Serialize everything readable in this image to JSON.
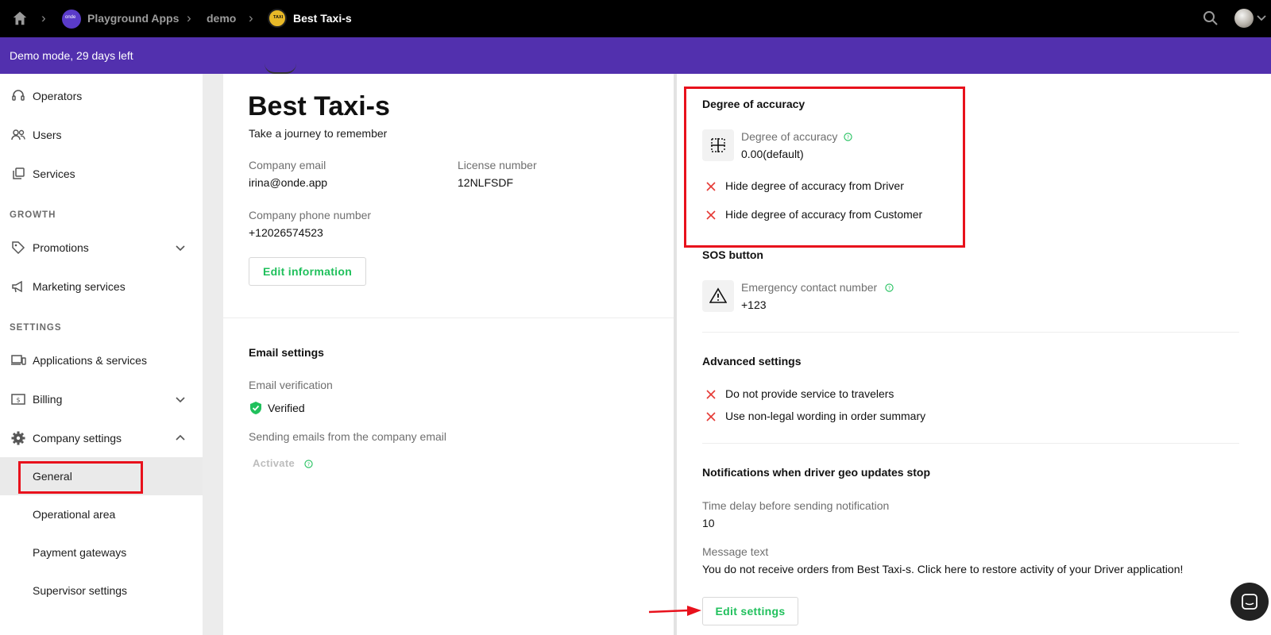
{
  "topbar": {
    "breadcrumbs": [
      "Playground Apps",
      "demo",
      "Best Taxi-s"
    ],
    "org_logo_text": "onde",
    "app_logo_text": "TAXI"
  },
  "banner": {
    "text": "Demo mode, 29 days left"
  },
  "sidebar": {
    "items_top": [
      {
        "label": "Operators",
        "icon": "headset-icon"
      },
      {
        "label": "Users",
        "icon": "users-icon"
      },
      {
        "label": "Services",
        "icon": "services-icon"
      }
    ],
    "section_growth": "GROWTH",
    "items_growth": [
      {
        "label": "Promotions",
        "icon": "tag-icon"
      },
      {
        "label": "Marketing services",
        "icon": "megaphone-icon"
      }
    ],
    "section_settings": "SETTINGS",
    "items_settings": [
      {
        "label": "Applications & services",
        "icon": "devices-icon"
      },
      {
        "label": "Billing",
        "icon": "billing-icon"
      },
      {
        "label": "Company settings",
        "icon": "gear-icon"
      }
    ],
    "company_sub": [
      "General",
      "Operational area",
      "Payment gateways",
      "Supervisor settings"
    ],
    "active_sub": "General"
  },
  "company": {
    "name": "Best Taxi-s",
    "tagline": "Take a journey to remember",
    "email_label": "Company email",
    "email": "irina@onde.app",
    "license_label": "License number",
    "license": "12NLFSDF",
    "phone_label": "Company phone number",
    "phone": "+12026574523",
    "edit_button": "Edit information"
  },
  "email_settings": {
    "title": "Email settings",
    "verification_label": "Email verification",
    "verification_status": "Verified",
    "sending_label": "Sending emails from the company email",
    "activate_label": "Activate"
  },
  "accuracy": {
    "title": "Degree of accuracy",
    "field_label": "Degree of accuracy",
    "field_value": "0.00(default)",
    "options": [
      "Hide degree of accuracy from Driver",
      "Hide degree of accuracy from Customer"
    ]
  },
  "sos": {
    "title": "SOS button",
    "field_label": "Emergency contact number",
    "field_value": "+123"
  },
  "advanced": {
    "title": "Advanced settings",
    "options": [
      "Do not provide service to travelers",
      "Use non-legal wording in order summary"
    ]
  },
  "notifications": {
    "title": "Notifications when driver geo updates stop",
    "delay_label": "Time delay before sending notification",
    "delay_value": "10",
    "message_label": "Message text",
    "message_value": "You do not receive orders from Best Taxi-s. Click here to restore activity of your Driver application!"
  },
  "edit_settings_button": "Edit settings",
  "colors": {
    "accent_green": "#20c05c",
    "banner_purple": "#5230ae",
    "highlight_red": "#e8111c"
  }
}
